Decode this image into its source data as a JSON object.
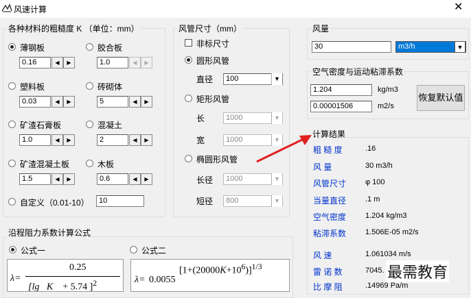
{
  "window": {
    "title": "风速计算",
    "close_glyph": "✕"
  },
  "materials": {
    "legend": "各种材料的粗糙度 K （单位：mm）",
    "items": [
      {
        "label": "薄钢板",
        "value": "0.16",
        "selected": true
      },
      {
        "label": "胶合板",
        "value": "1.0",
        "selected": false
      },
      {
        "label": "塑料板",
        "value": "0.03",
        "selected": false
      },
      {
        "label": "砖砌体",
        "value": "5",
        "selected": false
      },
      {
        "label": "矿渣石膏板",
        "value": "1.0",
        "selected": false
      },
      {
        "label": "混凝土",
        "value": "2",
        "selected": false
      },
      {
        "label": "矿渣混凝土板",
        "value": "1.5",
        "selected": false
      },
      {
        "label": "木板",
        "value": "0.6",
        "selected": false
      }
    ],
    "custom_label": "自定义（0.01-10）",
    "custom_value": "10"
  },
  "duct": {
    "legend": "风管尺寸（mm）",
    "nonstandard_label": "非标尺寸",
    "round_label": "圆形风管",
    "diameter_label": "直径",
    "diameter_value": "100",
    "rect_label": "矩形风管",
    "length_label": "长",
    "length_value": "1000",
    "width_label": "宽",
    "width_value": "1000",
    "ellipse_label": "椭圆形风管",
    "major_label": "长径",
    "major_value": "1000",
    "minor_label": "短径",
    "minor_value": "800"
  },
  "flow": {
    "legend": "风量",
    "value": "30",
    "unit": "m3/h"
  },
  "air": {
    "legend": "空气密度与运动粘滞系数",
    "density_value": "1.204",
    "density_unit": "kg/m3",
    "viscosity_value": "0.00001506",
    "viscosity_unit": "m2/s",
    "reset_label": "恢复默认值"
  },
  "results": {
    "legend": "计算结果",
    "rows": [
      {
        "label": "粗 糙 度",
        "value": ".16"
      },
      {
        "label": "风   量",
        "value": "30 m3/h"
      },
      {
        "label": "风管尺寸",
        "value": "φ 100"
      },
      {
        "label": "当量直径",
        "value": ".1 m"
      },
      {
        "label": "空气密度",
        "value": "1.204 kg/m3"
      },
      {
        "label": "粘滞系数",
        "value": "1.506E-05 m2/s"
      },
      {
        "label": "风   速",
        "value": "1.061034 m/s"
      },
      {
        "label": "雷 诺 数",
        "value": "7045."
      },
      {
        "label": "比 摩 阻",
        "value": ".14969 Pa/m"
      }
    ]
  },
  "formula": {
    "legend": "沿程阻力系数计算公式",
    "option1": "公式一",
    "option2": "公式二",
    "f1_num": "0.25",
    "f2_coef": "0.0055"
  },
  "watermark": "最需教育",
  "colors": {
    "accent": "#0033cc",
    "arrow": "#e02020",
    "selection": "#0078d7"
  }
}
